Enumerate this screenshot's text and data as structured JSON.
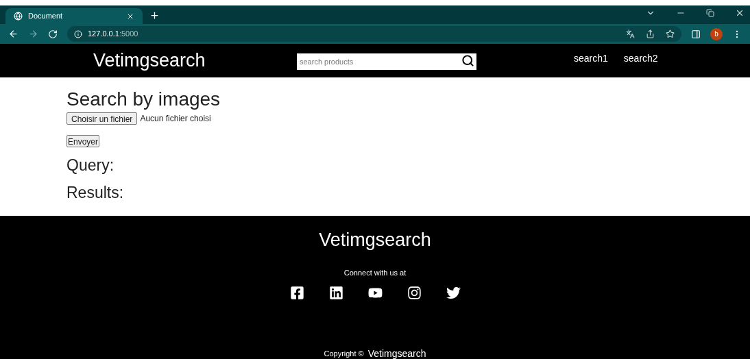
{
  "browser": {
    "tab_title": "Document",
    "url_host": "127.0.0.1",
    "url_port": ":5000",
    "profile_initial": "b"
  },
  "header": {
    "logo": "Vetimgsearch",
    "search": {
      "placeholder": "search products"
    },
    "nav": [
      "search1",
      "search2"
    ]
  },
  "main": {
    "title": "Search by images",
    "file_button": "Choisir un fichier",
    "file_status": "Aucun fichier choisi",
    "submit": "Envoyer",
    "query_heading": "Query:",
    "results_heading": "Results:"
  },
  "footer": {
    "logo": "Vetimgsearch",
    "connect": "Connect with us at",
    "social": [
      {
        "kind": "facebook"
      },
      {
        "kind": "linkedin"
      },
      {
        "kind": "youtube"
      },
      {
        "kind": "instagram"
      },
      {
        "kind": "twitter"
      }
    ],
    "copyright": "Copyright ©",
    "copyright_brand": "Vetimgsearch"
  }
}
